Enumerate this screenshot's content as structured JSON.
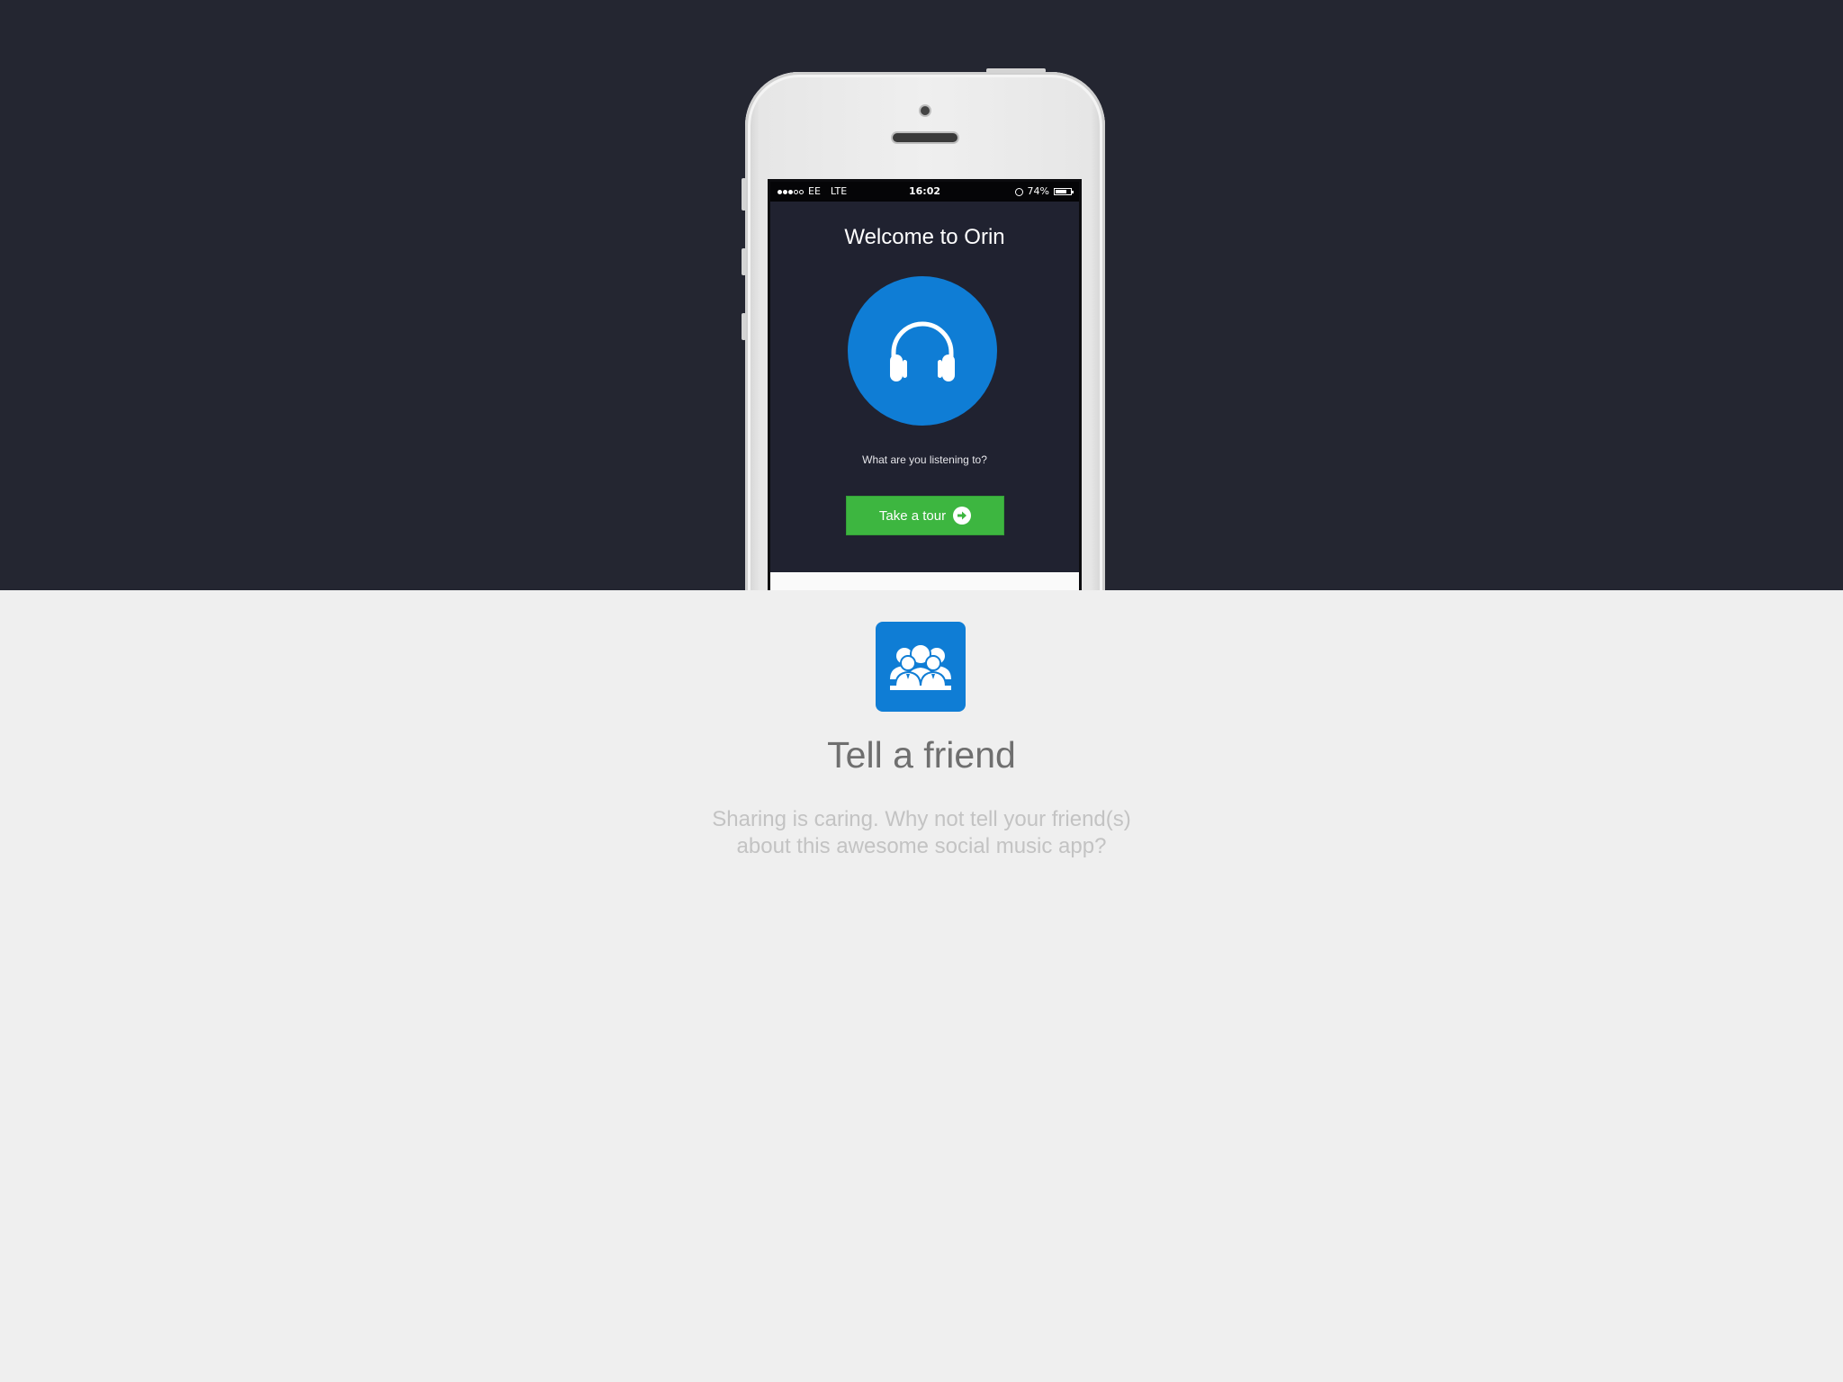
{
  "phone": {
    "status_bar": {
      "carrier": "EE",
      "network": "LTE",
      "time": "16:02",
      "battery": "74%",
      "battery_level": 0.74,
      "signal_bars_filled": 3,
      "signal_bars_total": 5
    },
    "screen": {
      "title": "Welcome to Orin",
      "hero_icon": "headphones-icon",
      "question": "What are you listening to?",
      "tour_button_label": "Take a tour",
      "tour_button_icon": "arrow-right-circle-icon"
    }
  },
  "feature": {
    "icon": "friends-group-icon",
    "title": "Tell a friend",
    "description_line1": "Sharing is caring. Why not tell your friend(s)",
    "description_line2": "about this awesome social music app?"
  },
  "colors": {
    "hero_background": "#242631",
    "page_background": "#efefef",
    "accent_blue": "#0f7dd5",
    "button_green": "#3db640"
  }
}
